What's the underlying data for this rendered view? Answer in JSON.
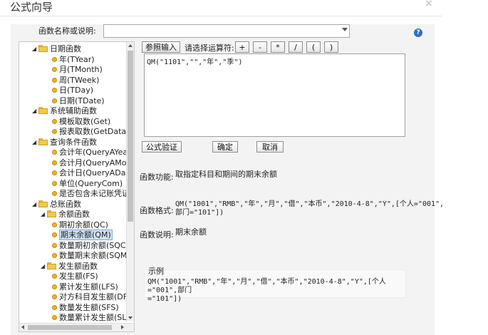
{
  "window": {
    "title": "公式向导",
    "close_glyph": "×"
  },
  "search": {
    "label": "函数名称或说明:",
    "value": ""
  },
  "help_glyph": "?",
  "tree": [
    {
      "id": "date",
      "label": "日期函数",
      "level": 0,
      "kind": "folder",
      "twisty": "◢"
    },
    {
      "id": "tyear",
      "label": "年(TYear)",
      "level": 2,
      "kind": "leaf"
    },
    {
      "id": "tmonth",
      "label": "月(TMonth)",
      "level": 2,
      "kind": "leaf"
    },
    {
      "id": "tweek",
      "label": "周(TWeek)",
      "level": 2,
      "kind": "leaf"
    },
    {
      "id": "tday",
      "label": "日(TDay)",
      "level": 2,
      "kind": "leaf"
    },
    {
      "id": "tdate",
      "label": "日期(TDate)",
      "level": 2,
      "kind": "leaf"
    },
    {
      "id": "sys",
      "label": "系统辅助函数",
      "level": 0,
      "kind": "folder",
      "twisty": "◢"
    },
    {
      "id": "get",
      "label": "模板取数(Get)",
      "level": 2,
      "kind": "leaf"
    },
    {
      "id": "getdata",
      "label": "报表取数(GetData)",
      "level": 2,
      "kind": "leaf"
    },
    {
      "id": "query",
      "label": "查询条件函数",
      "level": 0,
      "kind": "folder",
      "twisty": "◢"
    },
    {
      "id": "qyear",
      "label": "会计年(QueryAYear)",
      "level": 2,
      "kind": "leaf"
    },
    {
      "id": "qmonth",
      "label": "会计月(QueryAMonth)",
      "level": 2,
      "kind": "leaf"
    },
    {
      "id": "qday",
      "label": "会计日(QueryADay)",
      "level": 2,
      "kind": "leaf"
    },
    {
      "id": "qcom",
      "label": "单位(QueryCom)",
      "level": 2,
      "kind": "leaf"
    },
    {
      "id": "unposted",
      "label": "是否包含未记账凭证",
      "level": 2,
      "kind": "leaf"
    },
    {
      "id": "ledger",
      "label": "总账函数",
      "level": 0,
      "kind": "folder",
      "twisty": "◢"
    },
    {
      "id": "balance",
      "label": "余额函数",
      "level": 1,
      "kind": "folder",
      "twisty": "◢"
    },
    {
      "id": "qc",
      "label": "期初余额(QC)",
      "level": 2,
      "kind": "leaf"
    },
    {
      "id": "qm",
      "label": "期末余额(QM)",
      "level": 2,
      "kind": "leaf",
      "selected": true
    },
    {
      "id": "sqc",
      "label": "数量期初余额(SQC)",
      "level": 2,
      "kind": "leaf"
    },
    {
      "id": "sqm",
      "label": "数量期末余额(SQM)",
      "level": 2,
      "kind": "leaf"
    },
    {
      "id": "occur",
      "label": "发生额函数",
      "level": 1,
      "kind": "folder",
      "twisty": "◢"
    },
    {
      "id": "fs",
      "label": "发生额(FS)",
      "level": 2,
      "kind": "leaf"
    },
    {
      "id": "lfs",
      "label": "累计发生额(LFS)",
      "level": 2,
      "kind": "leaf"
    },
    {
      "id": "dfs",
      "label": "对方科目发生额(DFS)",
      "level": 2,
      "kind": "leaf"
    },
    {
      "id": "sfs",
      "label": "数量发生额(SFS)",
      "level": 2,
      "kind": "leaf"
    },
    {
      "id": "slfs",
      "label": "数量累计发生额(SLFS)",
      "level": 2,
      "kind": "leaf"
    }
  ],
  "toolbar": {
    "ref_input": "参照输入",
    "op_label": "请选择运算符:",
    "operators": [
      "+",
      "-",
      "*",
      "/",
      "(",
      ")"
    ]
  },
  "formula": "QM(\"1101\",\"\",\"年\",\"季\")",
  "buttons": {
    "validate": "公式验证",
    "ok": "确定",
    "cancel": "取消"
  },
  "function_info": {
    "func_label": "函数功能:",
    "func_value": "取指定科目和期间的期末余额",
    "format_label": "函数格式:",
    "format_value_1": "QM(\"1001\",\"RMB\",\"年\",\"月\",\"借\",\"本币\",\"2010-4-8\",\"Y\",[个人=\"001\",",
    "format_value_2": "部门=\"101\"])",
    "desc_label": "函数说明:",
    "desc_value": "期末余额",
    "example_label": "示例",
    "example_value_1": "QM(\"1001\",\"RMB\",\"年\",\"月\",\"借\",\"本币\",\"2010-4-8\",\"Y\",[个人=\"001\",部门",
    "example_value_2": "=\"101\"])"
  }
}
